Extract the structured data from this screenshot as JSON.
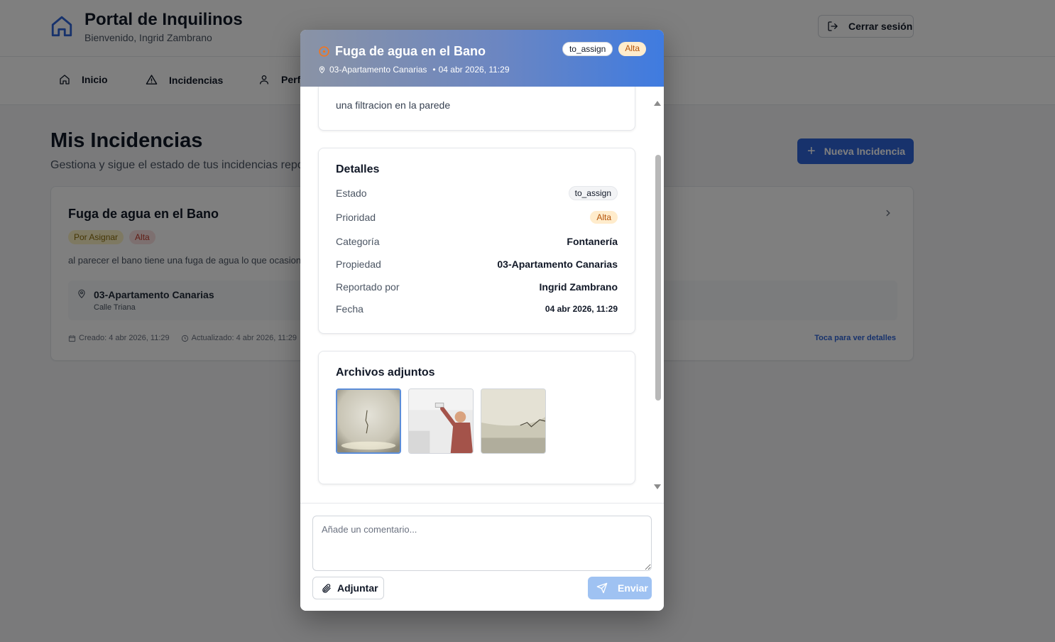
{
  "header": {
    "title": "Portal de Inquilinos",
    "subtitle": "Bienvenido, Ingrid Zambrano",
    "logout_label": "Cerrar sesión"
  },
  "nav": {
    "items": [
      {
        "label": "Inicio",
        "icon": "home-icon"
      },
      {
        "label": "Incidencias",
        "icon": "warning-icon"
      },
      {
        "label": "Perfil",
        "icon": "user-icon"
      }
    ]
  },
  "main": {
    "title": "Mis Incidencias",
    "subtitle": "Gestiona y sigue el estado de tus incidencias reportadas",
    "new_button": "Nueva Incidencia"
  },
  "card": {
    "title": "Fuga de agua en el Bano",
    "status_badge": "Por Asignar",
    "priority_badge": "Alta",
    "description": "al parecer el bano tiene una fuga de agua lo que ocasiona una filtracion en la pared",
    "property_name": "03-Apartamento Canarias",
    "property_address": "Calle Triana",
    "created": "Creado: 4 abr 2026, 11:29",
    "updated": "Actualizado: 4 abr 2026, 11:29",
    "link": "Toca para ver detalles"
  },
  "modal": {
    "title": "Fuga de agua en el Bano",
    "property": "03-Apartamento Canarias",
    "date": "04 abr 2026, 11:29",
    "status_badge": "to_assign",
    "priority_badge": "Alta",
    "description_tail": "una filtracion en la parede",
    "details": {
      "title": "Detalles",
      "estado_label": "Estado",
      "estado_value": "to_assign",
      "prioridad_label": "Prioridad",
      "prioridad_value": "Alta",
      "categoria_label": "Categoría",
      "categoria_value": "Fontanería",
      "propiedad_label": "Propiedad",
      "propiedad_value": "03-Apartamento Canarias",
      "reportado_label": "Reportado por",
      "reportado_value": "Ingrid Zambrano",
      "fecha_label": "Fecha",
      "fecha_value": "04 abr 2026, 11:29"
    },
    "attachments": {
      "title": "Archivos adjuntos"
    },
    "comment_placeholder": "Añade un comentario...",
    "attach_label": "Adjuntar",
    "send_label": "Enviar"
  },
  "colors": {
    "accent": "#2f65d8",
    "priority_bg": "#ffeccc",
    "priority_text": "#b45309"
  }
}
